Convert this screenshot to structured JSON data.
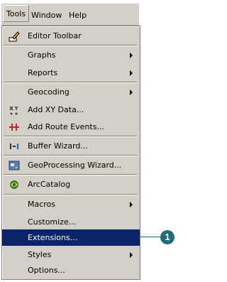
{
  "menubar": {
    "items": [
      {
        "label": "Tools",
        "mnemonic": "T"
      },
      {
        "label": "Window",
        "mnemonic": "W"
      },
      {
        "label": "Help",
        "mnemonic": "H"
      }
    ]
  },
  "menu": {
    "items": [
      {
        "label": "Editor Toolbar",
        "icon": "editor-icon"
      },
      {
        "label": "Graphs",
        "submenu": true
      },
      {
        "label": "Reports",
        "submenu": true
      },
      {
        "label": "Geocoding",
        "submenu": true
      },
      {
        "label": "Add XY Data...",
        "icon": "xy-data-icon"
      },
      {
        "label": "Add Route Events...",
        "icon": "route-events-icon"
      },
      {
        "label": "Buffer Wizard...",
        "icon": "buffer-icon"
      },
      {
        "label": "GeoProcessing Wizard...",
        "icon": "geoprocessing-icon"
      },
      {
        "label": "ArcCatalog",
        "icon": "arccatalog-icon"
      },
      {
        "label": "Macros",
        "submenu": true
      },
      {
        "label": "Customize..."
      },
      {
        "label": "Extensions...",
        "selected": true
      },
      {
        "label": "Styles",
        "submenu": true
      },
      {
        "label": "Options..."
      }
    ]
  },
  "callout": {
    "number": "1"
  },
  "colors": {
    "highlight": "#0a246a",
    "callout": "#1f6d78",
    "menu_bg": "#d4d0c8"
  }
}
